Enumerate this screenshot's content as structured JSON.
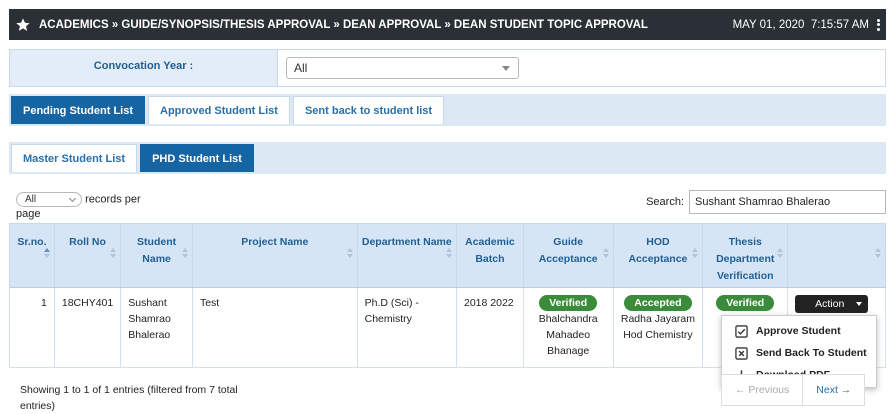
{
  "header": {
    "breadcrumb": "ACADEMICS » GUIDE/SYNOPSIS/THESIS APPROVAL » DEAN APPROVAL » DEAN STUDENT TOPIC APPROVAL",
    "date": "MAY 01, 2020",
    "time": "7:15:57 AM"
  },
  "filter": {
    "convocation_label": "Convocation Year :",
    "convocation_value": "All"
  },
  "status_tabs": [
    "Pending Student List",
    "Approved Student List",
    "Sent back to student list"
  ],
  "list_tabs": [
    "Master Student List",
    "PHD Student List"
  ],
  "table_controls": {
    "length_value": "All",
    "records_per": "records per",
    "page": "page",
    "search_label": "Search:",
    "search_value": "Sushant Shamrao Bhalerao"
  },
  "columns": [
    "Sr.no.",
    "Roll No",
    "Student Name",
    "Project Name",
    "Department Name",
    "Academic Batch",
    "Guide Acceptance",
    "HOD Acceptance",
    "Thesis Department Verification",
    ""
  ],
  "rows": [
    {
      "sr": "1",
      "roll": "18CHY401",
      "student": "Sushant Shamrao Bhalerao",
      "project": "Test",
      "department": "Ph.D (Sci) - Chemistry",
      "batch": "2018 2022",
      "guide_status": "Verified",
      "guide_name": "Bhalchandra Mahadeo Bhanage",
      "hod_status": "Accepted",
      "hod_name": "Radha Jayaram Hod Chemistry",
      "thesis_status": "Verified",
      "action_label": "Action"
    }
  ],
  "action_menu": [
    "Approve Student",
    "Send Back To Student",
    "Download PDF"
  ],
  "footer": {
    "info": "Showing 1 to 1 of 1 entries (filtered from 7 total entries)",
    "previous": "← Previous",
    "next": "Next →"
  },
  "colors": {
    "topbar": "#2b3036",
    "accent": "#1564a3",
    "header_bg": "#d6e5f5",
    "badge_green": "#3a8c3a"
  }
}
